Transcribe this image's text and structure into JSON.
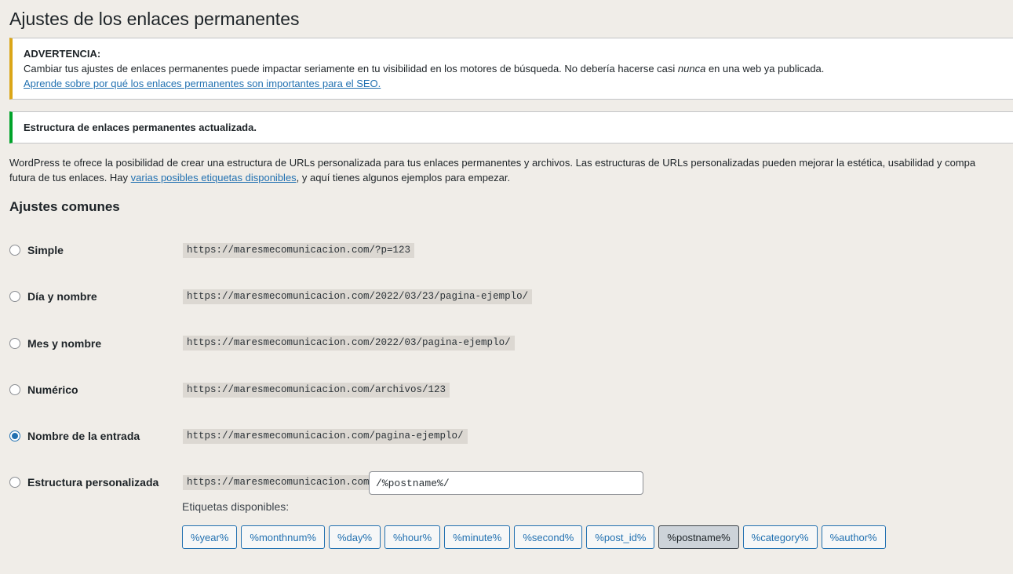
{
  "page_title": "Ajustes de los enlaces permanentes",
  "warning": {
    "heading": "ADVERTENCIA:",
    "text_before": "Cambiar tus ajustes de enlaces permanentes puede impactar seriamente en tu visibilidad en los motores de búsqueda. No debería hacerse casi ",
    "text_emphasis": "nunca",
    "text_after": " en una web ya publicada.",
    "link": "Aprende sobre por qué los enlaces permanentes son importantes para el SEO."
  },
  "success": {
    "text": "Estructura de enlaces permanentes actualizada."
  },
  "intro": {
    "line1": "WordPress te ofrece la posibilidad de crear una estructura de URLs personalizada para tus enlaces permanentes y archivos. Las estructuras de URLs personalizadas pueden mejorar la estética, usabilidad y compa",
    "line2_before": "futura de tus enlaces. Hay ",
    "line2_link": "varias posibles etiquetas disponibles",
    "line2_after": ", y aquí tienes algunos ejemplos para empezar."
  },
  "section_title": "Ajustes comunes",
  "options": [
    {
      "label": "Simple",
      "url": "https://maresmecomunicacion.com/?p=123",
      "checked": false
    },
    {
      "label": "Día y nombre",
      "url": "https://maresmecomunicacion.com/2022/03/23/pagina-ejemplo/",
      "checked": false
    },
    {
      "label": "Mes y nombre",
      "url": "https://maresmecomunicacion.com/2022/03/pagina-ejemplo/",
      "checked": false
    },
    {
      "label": "Numérico",
      "url": "https://maresmecomunicacion.com/archivos/123",
      "checked": false
    },
    {
      "label": "Nombre de la entrada",
      "url": "https://maresmecomunicacion.com/pagina-ejemplo/",
      "checked": true
    },
    {
      "label": "Estructura personalizada",
      "url": "https://maresmecomunicacion.com",
      "checked": false
    }
  ],
  "custom_structure_value": "/%postname%/",
  "tags_label": "Etiquetas disponibles:",
  "tags": [
    "%year%",
    "%monthnum%",
    "%day%",
    "%hour%",
    "%minute%",
    "%second%",
    "%post_id%",
    "%postname%",
    "%category%",
    "%author%"
  ],
  "active_tag": "%postname%",
  "colors": {
    "background": "#f0ede8",
    "accent": "#2271b1",
    "warning": "#dba617",
    "success": "#00a32a"
  }
}
